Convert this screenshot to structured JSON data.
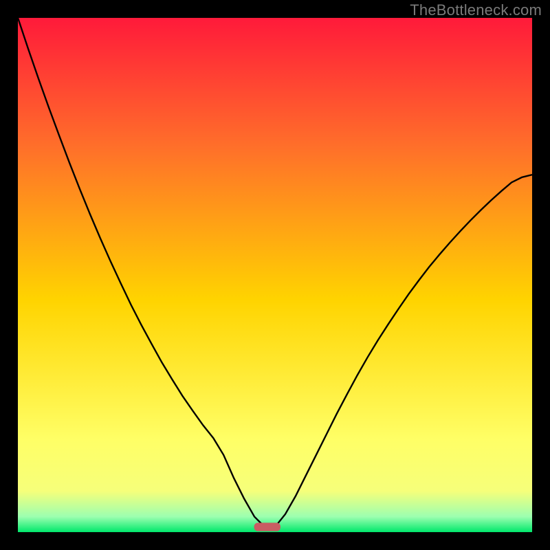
{
  "watermark": "TheBottleneck.com",
  "colors": {
    "frame": "#000000",
    "gradient_top": "#ff1a3a",
    "gradient_mid_upper": "#ff6f2a",
    "gradient_mid": "#ffd400",
    "gradient_low": "#f6ff7a",
    "gradient_bottom": "#00e86b",
    "curve": "#000000",
    "marker_fill": "#c95d63",
    "marker_stroke": "#c95d63"
  },
  "chart_data": {
    "type": "line",
    "title": "",
    "xlabel": "",
    "ylabel": "",
    "xlim": [
      0,
      100
    ],
    "ylim": [
      0,
      100
    ],
    "series": [
      {
        "name": "bottleneck-curve",
        "x": [
          0,
          2,
          4,
          6,
          8,
          10,
          12,
          14,
          16,
          18,
          20,
          22,
          24,
          26,
          28,
          30,
          32,
          34,
          36,
          38,
          40,
          42,
          44,
          46,
          48,
          50,
          52,
          54,
          56,
          58,
          60,
          62,
          64,
          66,
          68,
          70,
          72,
          74,
          76,
          78,
          80,
          82,
          84,
          86,
          88,
          90,
          92,
          94,
          96,
          98,
          100
        ],
        "y": [
          100,
          94.0,
          88.2,
          82.6,
          77.2,
          71.9,
          66.8,
          61.9,
          57.2,
          52.7,
          48.4,
          44.2,
          40.3,
          36.6,
          33.0,
          29.7,
          26.5,
          23.6,
          20.8,
          18.3,
          15.0,
          10.5,
          6.5,
          3.0,
          1.0,
          1.0,
          3.5,
          7.0,
          11.0,
          15.0,
          19.0,
          23.0,
          26.8,
          30.5,
          34.0,
          37.3,
          40.4,
          43.4,
          46.3,
          49.0,
          51.6,
          54.0,
          56.3,
          58.5,
          60.6,
          62.6,
          64.5,
          66.3,
          68.0,
          69.0,
          69.5
        ]
      }
    ],
    "marker": {
      "name": "optimal-point",
      "x": 48.5,
      "y": 1.0,
      "width": 5,
      "height": 1.5
    },
    "gradient_stops": [
      {
        "offset": 0,
        "color": "#ff1a3a"
      },
      {
        "offset": 25,
        "color": "#ff6f2a"
      },
      {
        "offset": 55,
        "color": "#ffd400"
      },
      {
        "offset": 82,
        "color": "#ffff66"
      },
      {
        "offset": 92,
        "color": "#f6ff7a"
      },
      {
        "offset": 97,
        "color": "#9cffb0"
      },
      {
        "offset": 100,
        "color": "#00e86b"
      }
    ]
  }
}
